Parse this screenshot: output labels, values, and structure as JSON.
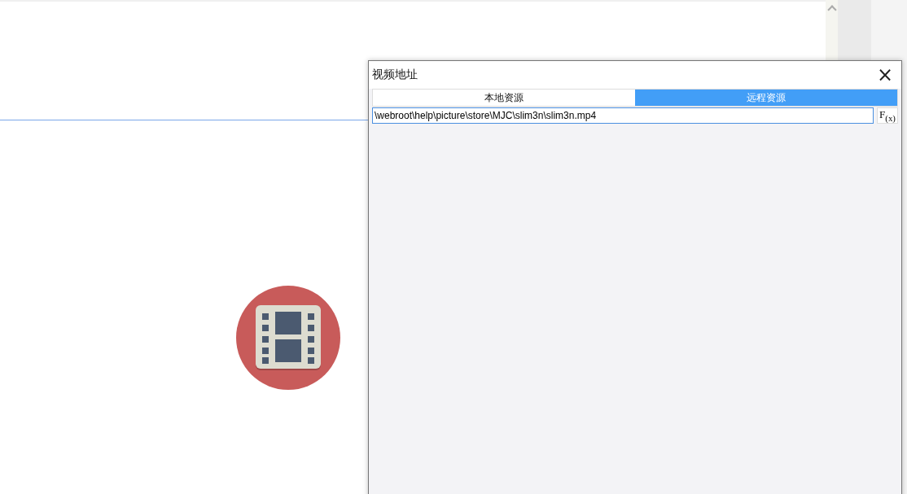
{
  "dialog": {
    "title": "视频地址",
    "close": "×"
  },
  "tabs": [
    {
      "label": "本地资源",
      "selected": false
    },
    {
      "label": "远程资源",
      "selected": true
    }
  ],
  "path_field": {
    "value": "\\webroot\\help\\picture\\store\\MJC\\slim3n\\slim3n.mp4"
  },
  "formula_button": {
    "label": "F",
    "sub": "(x)"
  }
}
